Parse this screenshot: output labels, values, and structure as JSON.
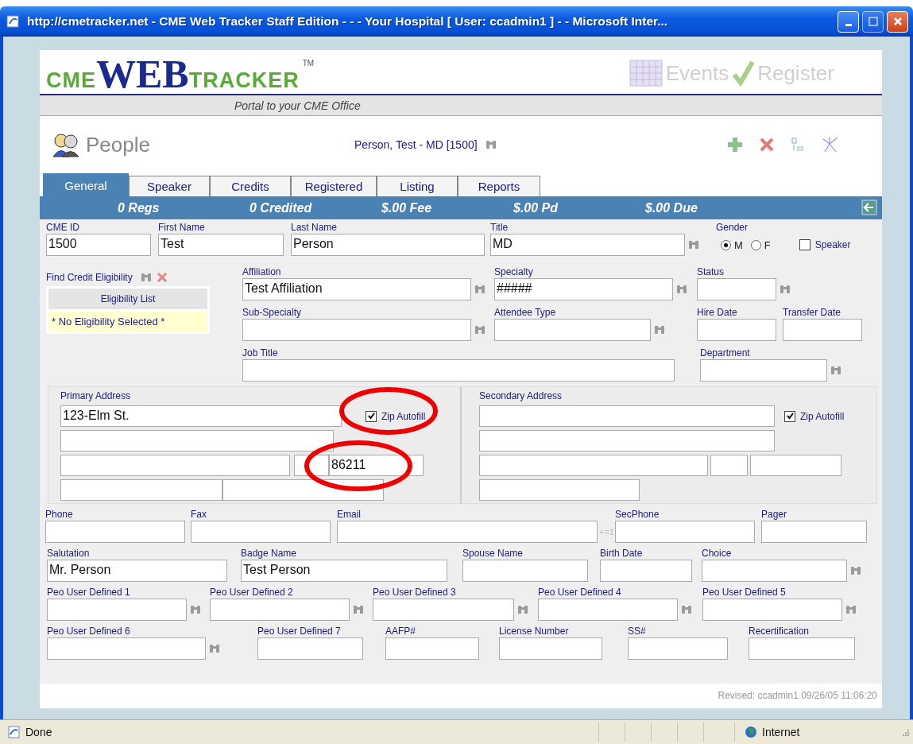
{
  "window": {
    "title": "http://cmetracker.net - CME Web Tracker Staff Edition - - - Your Hospital [ User: ccadmin1 ] -  - Microsoft Inter..."
  },
  "header": {
    "logo": {
      "prefix": "CME",
      "main": "WEB",
      "suffix": "TRACKER",
      "mark": "TM"
    },
    "tagline": "Portal to your CME Office",
    "nav": [
      "Events",
      "Register"
    ]
  },
  "page": {
    "title": "People",
    "record": "Person, Test - MD [1500]"
  },
  "tabs": [
    {
      "label": "General",
      "selected": true
    },
    {
      "label": "Speaker",
      "selected": false
    },
    {
      "label": "Credits",
      "selected": false
    },
    {
      "label": "Registered",
      "selected": false
    },
    {
      "label": "Listing",
      "selected": false
    },
    {
      "label": "Reports",
      "selected": false
    }
  ],
  "summary": [
    "0 Regs",
    "0 Credited",
    "$.00 Fee",
    "$.00 Pd",
    "$.00 Due"
  ],
  "row1": [
    {
      "label": "CME ID",
      "value": "1500",
      "lookup": false
    },
    {
      "label": "First Name",
      "value": "Test",
      "lookup": false
    },
    {
      "label": "Last Name",
      "value": "Person",
      "lookup": false
    },
    {
      "label": "Title",
      "value": "MD",
      "lookup": true
    }
  ],
  "gender": {
    "label": "Gender",
    "options": [
      {
        "label": "M",
        "selected": true
      },
      {
        "label": "F",
        "selected": false
      }
    ]
  },
  "speaker": {
    "label": "Speaker",
    "checked": false
  },
  "eligibility": {
    "label": "Find Credit Eligibility",
    "header": "Eligibility List",
    "empty": "* No Eligibility Selected *"
  },
  "details": [
    [
      {
        "label": "Affiliation",
        "value": "Test Affiliation",
        "lookup": true
      },
      {
        "label": "Specialty",
        "value": "#####",
        "lookup": true
      },
      {
        "label": "Status",
        "lookup": true
      }
    ],
    [
      {
        "label": "Sub-Specialty",
        "lookup": true
      },
      {
        "label": "Attendee Type",
        "lookup": true
      },
      {
        "label": "Hire Date",
        "lookup": false
      },
      {
        "label": "Transfer Date",
        "lookup": false
      }
    ],
    [
      {
        "label": "Job Title",
        "lookup": false
      },
      {
        "label": "Department",
        "lookup": true
      }
    ]
  ],
  "primary_address": {
    "label": "Primary Address",
    "street": "123-Elm St.",
    "zip": {
      "value": "86211",
      "highlighted": true
    },
    "zip_autofill": {
      "label": "Zip Autofill",
      "checked": true,
      "highlighted": true
    }
  },
  "secondary_address": {
    "label": "Secondary Address",
    "zip_autofill": {
      "label": "Zip Autofill",
      "checked": true,
      "highlighted": false
    }
  },
  "rows": [
    [
      {
        "label": "Phone",
        "lookup": false
      },
      {
        "label": "Fax",
        "lookup": false
      },
      {
        "label": "Email",
        "lookup": false,
        "suffix": "+=1"
      },
      {
        "label": "SecPhone",
        "lookup": false
      },
      {
        "label": "Pager",
        "lookup": false
      }
    ],
    [
      {
        "label": "Salutation",
        "value": "Mr. Person",
        "lookup": false
      },
      {
        "label": "Badge Name",
        "value": "Test Person",
        "lookup": false
      },
      {
        "label": "Spouse Name",
        "lookup": false
      },
      {
        "label": "Birth Date",
        "lookup": false
      },
      {
        "label": "Choice",
        "lookup": true
      }
    ],
    [
      {
        "label": "Peo User Defined 1",
        "lookup": true
      },
      {
        "label": "Peo User Defined 2",
        "lookup": true
      },
      {
        "label": "Peo User Defined 3",
        "lookup": true
      },
      {
        "label": "Peo User Defined 4",
        "lookup": true
      },
      {
        "label": "Peo User Defined 5",
        "lookup": true
      }
    ],
    [
      {
        "label": "Peo User Defined 6",
        "lookup": true
      },
      {
        "label": "Peo User Defined 7",
        "lookup": false
      },
      {
        "label": "AAFP#",
        "lookup": false
      },
      {
        "label": "License Number",
        "lookup": false
      },
      {
        "label": "SS#",
        "lookup": false
      },
      {
        "label": "Recertification",
        "lookup": false
      }
    ]
  ],
  "revised": "Revised: ccadmin1 09/26/05 11:06:20",
  "status_bar": {
    "text": "Done",
    "zone": "Internet"
  }
}
